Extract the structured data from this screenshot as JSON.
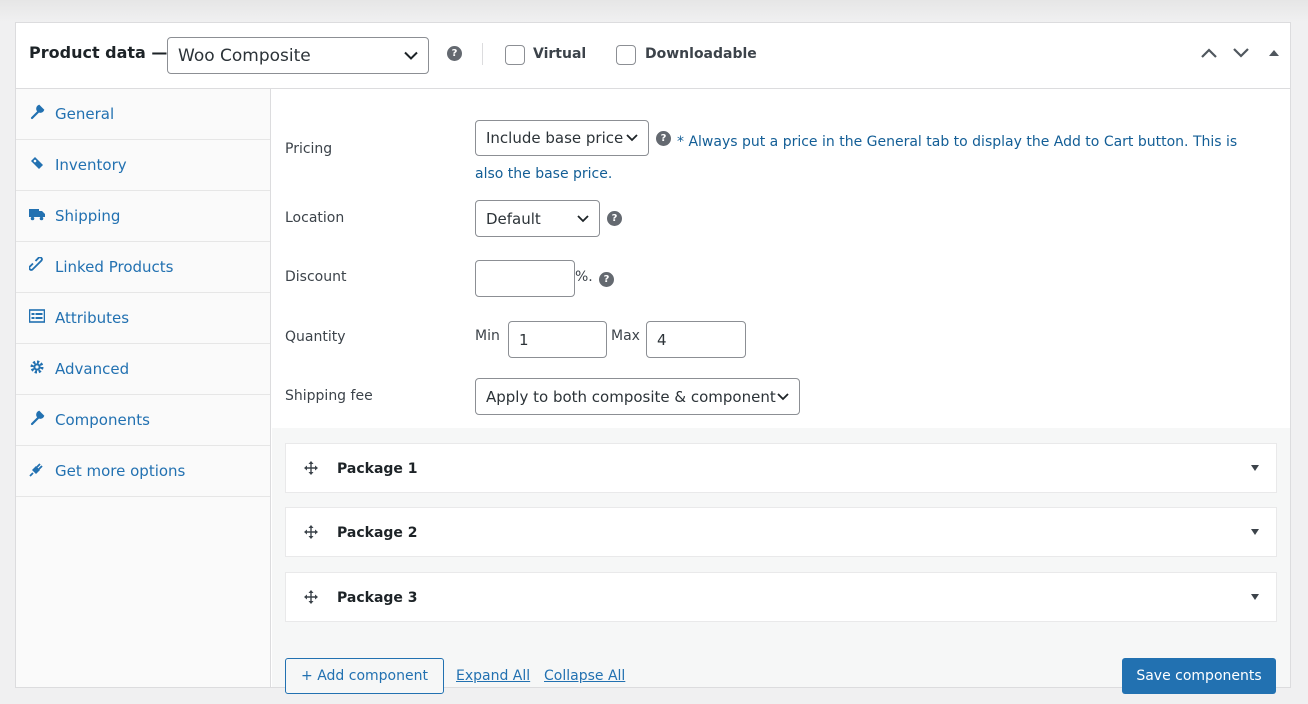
{
  "header": {
    "title": "Product data —",
    "product_type": "Woo Composite",
    "help_symbol": "?",
    "virtual_label": "Virtual",
    "downloadable_label": "Downloadable",
    "virtual_checked": false,
    "downloadable_checked": false,
    "icons": [
      "chevron-up-icon",
      "chevron-down-icon",
      "collapse-arrow-icon"
    ]
  },
  "sidebar": {
    "items": [
      {
        "label": "General",
        "icon": "wrench-icon"
      },
      {
        "label": "Inventory",
        "icon": "tag-icon"
      },
      {
        "label": "Shipping",
        "icon": "truck-icon"
      },
      {
        "label": "Linked Products",
        "icon": "link-icon"
      },
      {
        "label": "Attributes",
        "icon": "list-icon"
      },
      {
        "label": "Advanced",
        "icon": "gear-icon"
      },
      {
        "label": "Components",
        "icon": "wrench-icon"
      },
      {
        "label": "Get more options",
        "icon": "plugin-icon"
      }
    ]
  },
  "form": {
    "pricing": {
      "label": "Pricing",
      "value": "Include base price",
      "note": "* Always put a price in the General tab to display the Add to Cart button. This is also the base price."
    },
    "location": {
      "label": "Location",
      "value": "Default"
    },
    "discount": {
      "label": "Discount",
      "value": "",
      "suffix": "%."
    },
    "quantity": {
      "label": "Quantity",
      "min_label": "Min",
      "min_value": "1",
      "max_label": "Max",
      "max_value": "4"
    },
    "shipping_fee": {
      "label": "Shipping fee",
      "value": "Apply to both composite & component"
    }
  },
  "packages": [
    {
      "name": "Package 1"
    },
    {
      "name": "Package 2"
    },
    {
      "name": "Package 3"
    }
  ],
  "actions": {
    "add_component": "+ Add component",
    "expand_all": "Expand All",
    "collapse_all": "Collapse All",
    "save_components": "Save components"
  },
  "colors": {
    "accent": "#2271b1",
    "note_text": "#135e96",
    "background": "#f0f0f1"
  }
}
